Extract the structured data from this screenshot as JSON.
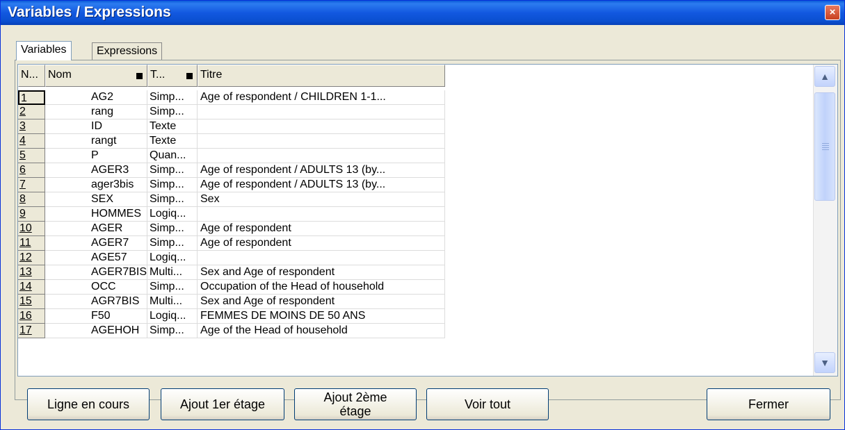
{
  "window": {
    "title": "Variables / Expressions",
    "close_label": "×"
  },
  "tabs": [
    {
      "label": "Variables",
      "active": true
    },
    {
      "label": "Expressions",
      "active": false
    }
  ],
  "grid": {
    "columns": [
      "N...",
      "Nom",
      "T...",
      "Titre"
    ],
    "rows": [
      {
        "n": "1",
        "nom": "AG2",
        "type": "Simp...",
        "titre": "Age of respondent / CHILDREN 1-1..."
      },
      {
        "n": "2",
        "nom": "rang",
        "type": "Simp...",
        "titre": ""
      },
      {
        "n": "3",
        "nom": "ID",
        "type": "Texte",
        "titre": ""
      },
      {
        "n": "4",
        "nom": "rangt",
        "type": "Texte",
        "titre": ""
      },
      {
        "n": "5",
        "nom": "P",
        "type": "Quan...",
        "titre": ""
      },
      {
        "n": "6",
        "nom": "AGER3",
        "type": "Simp...",
        "titre": "Age of respondent / ADULTS 13 (by..."
      },
      {
        "n": "7",
        "nom": "ager3bis",
        "type": "Simp...",
        "titre": "Age of respondent / ADULTS 13 (by..."
      },
      {
        "n": "8",
        "nom": "SEX",
        "type": "Simp...",
        "titre": "Sex"
      },
      {
        "n": "9",
        "nom": "HOMMES",
        "type": "Logiq...",
        "titre": ""
      },
      {
        "n": "10",
        "nom": "AGER",
        "type": "Simp...",
        "titre": "Age of respondent"
      },
      {
        "n": "11",
        "nom": "AGER7",
        "type": "Simp...",
        "titre": "Age of respondent"
      },
      {
        "n": "12",
        "nom": "AGE57",
        "type": "Logiq...",
        "titre": ""
      },
      {
        "n": "13",
        "nom": "AGER7BIS",
        "type": "Multi...",
        "titre": "Sex and Age of respondent"
      },
      {
        "n": "14",
        "nom": "OCC",
        "type": "Simp...",
        "titre": "Occupation of the Head of household"
      },
      {
        "n": "15",
        "nom": "AGR7BIS",
        "type": "Multi...",
        "titre": "Sex and Age of respondent"
      },
      {
        "n": "16",
        "nom": "F50",
        "type": "Logiq...",
        "titre": "FEMMES DE MOINS DE 50 ANS"
      },
      {
        "n": "17",
        "nom": "AGEHOH",
        "type": "Simp...",
        "titre": "Age of the Head of household"
      }
    ]
  },
  "buttons": {
    "ligne": "Ligne en cours",
    "ajout1": "Ajout 1er étage",
    "ajout2_line1": "Ajout 2ème",
    "ajout2_line2": "étage",
    "voir": "Voir tout",
    "fermer": "Fermer"
  }
}
